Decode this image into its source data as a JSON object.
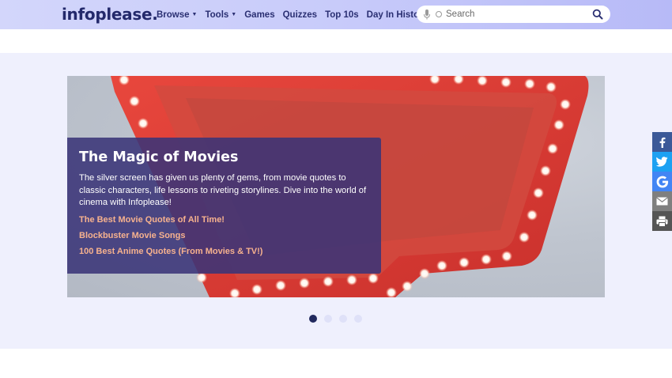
{
  "header": {
    "logo": "infoplease",
    "nav": [
      {
        "label": "Browse",
        "has_dropdown": true
      },
      {
        "label": "Tools",
        "has_dropdown": true
      },
      {
        "label": "Games",
        "has_dropdown": false
      },
      {
        "label": "Quizzes",
        "has_dropdown": false
      },
      {
        "label": "Top 10s",
        "has_dropdown": false
      },
      {
        "label": "Day In History",
        "has_dropdown": false
      }
    ],
    "search": {
      "placeholder": "Search"
    }
  },
  "hero": {
    "title": "The Magic of Movies",
    "description": "The silver screen has given us plenty of gems, from movie quotes to classic characters, life lessons to riveting storylines. Dive into the world of cinema with Infoplease!",
    "links": [
      "The Best Movie Quotes of All Time!",
      "Blockbuster Movie Songs",
      "100 Best Anime Quotes (From Movies & TV!)"
    ],
    "slides": {
      "count": 4,
      "active": 1
    }
  },
  "share": [
    "facebook-icon",
    "twitter-icon",
    "google-icon",
    "email-icon",
    "print-icon"
  ],
  "colors": {
    "brand_navy": "#23296b",
    "header_bg": "#c8cbfa",
    "hero_bg": "#eff0fd",
    "card_bg": "#3a3478",
    "link": "#f7b28e",
    "facebook": "#3b5998",
    "twitter": "#1da1f2",
    "google": "#4285f4",
    "email": "#7f7f7f",
    "print": "#555555"
  }
}
